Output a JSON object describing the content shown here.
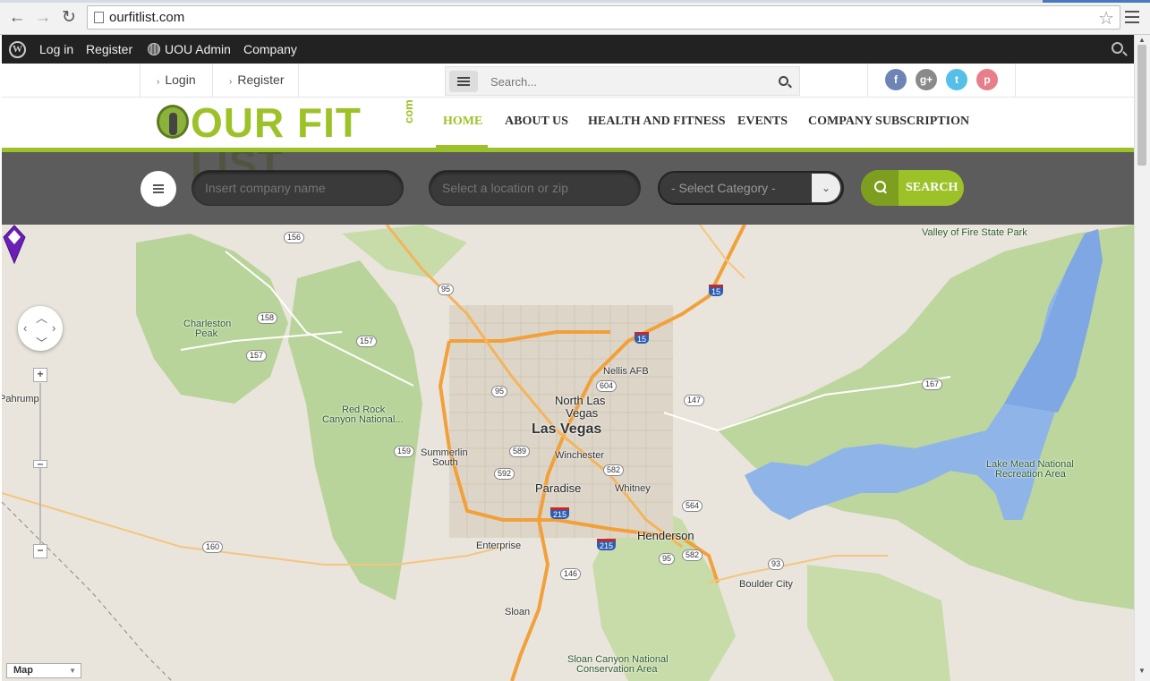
{
  "browser": {
    "back": "←",
    "forward": "→",
    "reload": "↻",
    "url": "ourfitlist.com",
    "star": "☆"
  },
  "admin_bar": {
    "wp_logo": "W",
    "login": "Log in",
    "register": "Register",
    "site": "UOU Admin",
    "company": "Company"
  },
  "topbar": {
    "login": "Login",
    "register": "Register",
    "search_placeholder": "Search...",
    "socials": [
      {
        "icon": "facebook-icon",
        "glyph": "f",
        "color": "#6d84b4"
      },
      {
        "icon": "google-plus-icon",
        "glyph": "g+",
        "color": "#8a8a8a"
      },
      {
        "icon": "twitter-icon",
        "glyph": "t",
        "color": "#55bfe8"
      },
      {
        "icon": "pinterest-icon",
        "glyph": "p",
        "color": "#e77e8a"
      }
    ]
  },
  "header": {
    "logo_text": "OUR FIT LIST",
    "logo_suffix": "com",
    "nav": [
      "HOME",
      "ABOUT US",
      "HEALTH AND FITNESS",
      "EVENTS",
      "COMPANY SUBSCRIPTION"
    ],
    "active_nav": "HOME",
    "accent": "#9dc229"
  },
  "search_bar": {
    "company_placeholder": "Insert company name",
    "location_placeholder": "Select a location or zip",
    "category_value": "- Select Category -",
    "search_label": "SEARCH"
  },
  "map": {
    "type_label": "Map",
    "zoom_in": "+",
    "zoom_out": "−",
    "places": {
      "las_vegas": "Las Vegas",
      "north_las_vegas_1": "North Las",
      "north_las_vegas_2": "Vegas",
      "paradise": "Paradise",
      "henderson": "Henderson",
      "winchester": "Winchester",
      "whitney": "Whitney",
      "enterprise": "Enterprise",
      "summerlin_1": "Summerlin",
      "summerlin_2": "South",
      "nellis": "Nellis AFB",
      "sloan": "Sloan",
      "boulder_city": "Boulder City",
      "pahrump": "Pahrump",
      "charleston_1": "Charleston",
      "charleston_2": "Peak",
      "red_rock_1": "Red Rock",
      "red_rock_2": "Canyon National...",
      "valley_of_fire": "Valley of Fire State Park",
      "lake_mead_1": "Lake Mead National",
      "lake_mead_2": "Recreation Area",
      "sloan_canyon_1": "Sloan Canyon National",
      "sloan_canyon_2": "Conservation Area"
    },
    "routes": {
      "r156": "156",
      "r95a": "95",
      "r15a": "15",
      "r158": "158",
      "r157a": "157",
      "r157b": "157",
      "r15b": "15",
      "r604": "604",
      "r95b": "95",
      "r147": "147",
      "r167": "167",
      "r159": "159",
      "r589": "589",
      "r592": "592",
      "r582a": "582",
      "r564": "564",
      "r215a": "215",
      "r215b": "215",
      "r95c": "95",
      "r582b": "582",
      "r93": "93",
      "r146": "146",
      "r160": "160",
      "r93b": "93"
    }
  }
}
